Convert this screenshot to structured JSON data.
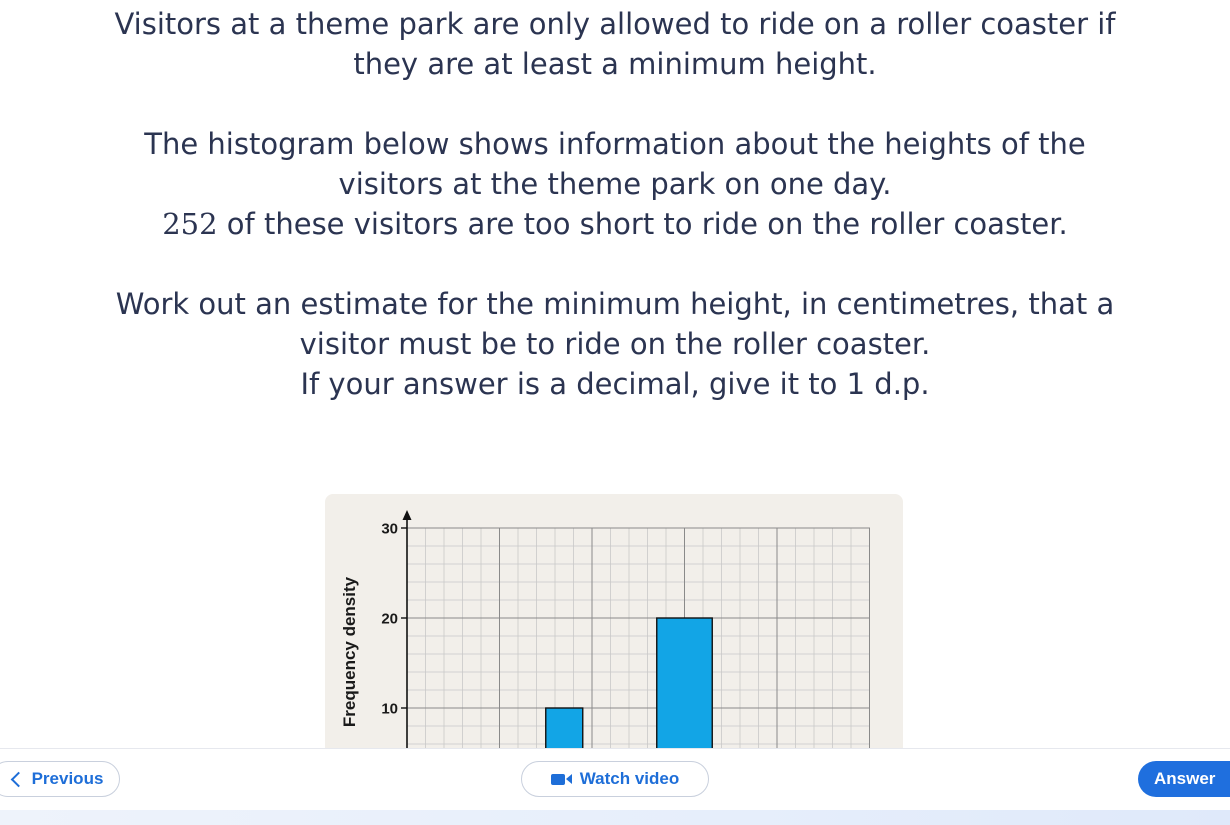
{
  "question": {
    "para1_line1": "Visitors at a theme park are only allowed to ride on a roller coaster if",
    "para1_line2": "they are at least a minimum height.",
    "para2_line1": "The histogram below shows information about the heights of the",
    "para2_line2": "visitors at the theme park on one day.",
    "para2_line3_number": "252",
    "para2_line3_text": " of these visitors are too short to ride on the roller coaster.",
    "para3_line1": "Work out an estimate for the minimum height, in centimetres, that a",
    "para3_line2": "visitor must be to ride on the roller coaster.",
    "para3_line3": "If your answer is a decimal, give it to 1 d.p."
  },
  "chart_data": {
    "type": "bar",
    "title": "",
    "xlabel": "",
    "ylabel": "Frequency density",
    "y_ticks": [
      "10",
      "20",
      "30"
    ],
    "ylim": [
      0,
      30
    ],
    "grid": true,
    "bar_color": "#12a5e6",
    "bars": [
      {
        "x_start": 7.5,
        "x_end": 9.5,
        "value": 10
      },
      {
        "x_start": 13.5,
        "x_end": 16.5,
        "value": 20
      }
    ],
    "visible_range_note_x": [
      0,
      25
    ],
    "visible_y_range": [
      8,
      30
    ]
  },
  "nav": {
    "previous_label": "Previous",
    "video_label": "Watch video",
    "answer_label": "Answer"
  },
  "colors": {
    "accent": "#1e6ed8",
    "text": "#2b3451",
    "figure_bg": "#f2efea"
  }
}
